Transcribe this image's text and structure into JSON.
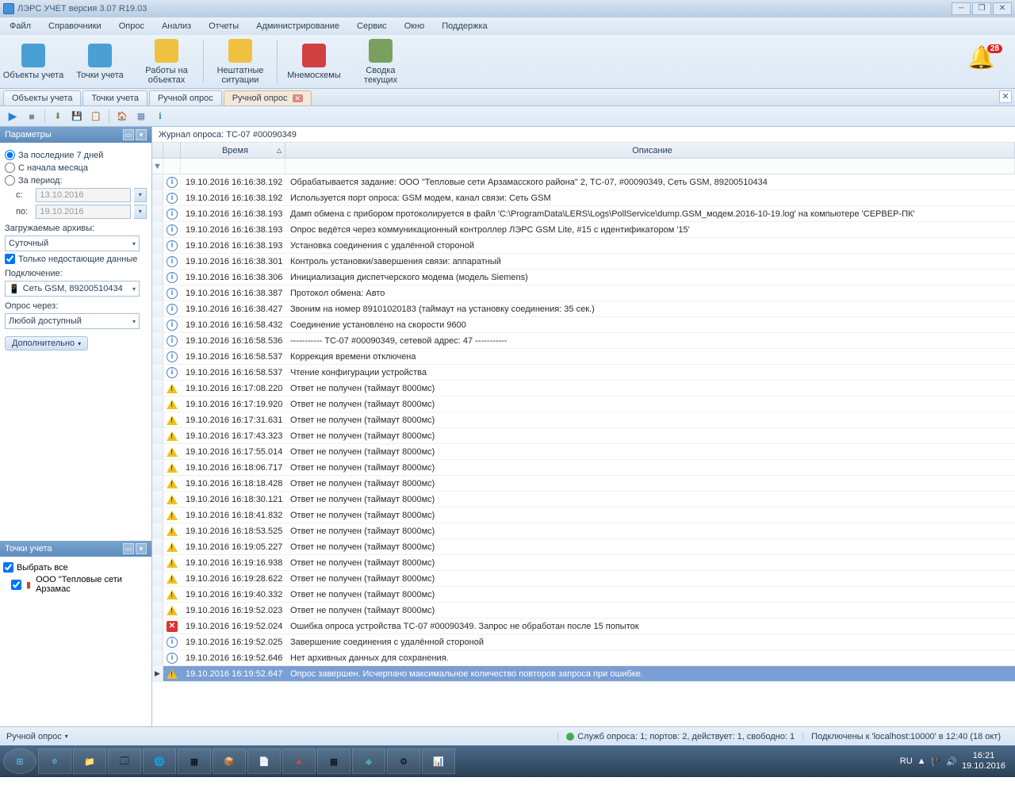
{
  "title": "ЛЭРС УЧЕТ версия 3.07 R19.03",
  "menu": [
    "Файл",
    "Справочники",
    "Опрос",
    "Анализ",
    "Отчеты",
    "Администрирование",
    "Сервис",
    "Окно",
    "Поддержка"
  ],
  "toolbar": [
    {
      "label": "Объекты учета",
      "color": "#4aa0d4"
    },
    {
      "label": "Точки учета",
      "color": "#4aa0d4"
    },
    {
      "label": "Работы на объектах",
      "color": "#f0c040"
    },
    {
      "label": "Нештатные ситуации",
      "color": "#f0c040"
    },
    {
      "label": "Мнемосхемы",
      "color": "#d04040"
    },
    {
      "label": "Сводка текущих",
      "color": "#7aa060"
    }
  ],
  "bell_count": "28",
  "tabs": [
    {
      "label": "Объекты учета",
      "active": false,
      "close": false
    },
    {
      "label": "Точки учета",
      "active": false,
      "close": false
    },
    {
      "label": "Ручной опрос",
      "active": false,
      "close": false
    },
    {
      "label": "Ручной опрос",
      "active": true,
      "close": true
    }
  ],
  "params": {
    "header": "Параметры",
    "opt_last7": "За последние 7 дней",
    "opt_month": "С начала месяца",
    "opt_period": "За период:",
    "from_lbl": "с:",
    "from_val": "13.10.2016",
    "to_lbl": "по:",
    "to_val": "19.10.2016",
    "archives_lbl": "Загружаемые архивы:",
    "archive_val": "Суточный",
    "missing_only": "Только недостающие данные",
    "connection_lbl": "Подключение:",
    "connection_val": "Сеть GSM, 89200510434",
    "pollvia_lbl": "Опрос через:",
    "pollvia_val": "Любой доступный",
    "more_btn": "Дополнительно"
  },
  "points": {
    "header": "Точки учета",
    "select_all": "Выбрать все",
    "item": "ООО \"Тепловые сети Арзамас"
  },
  "journal_title": "Журнал опроса: ТС-07 #00090349",
  "grid": {
    "col_time": "Время",
    "col_desc": "Описание"
  },
  "rows": [
    {
      "t": "i",
      "tm": "19.10.2016 16:16:38.192",
      "d": "Обрабатывается задание: ООО \"Тепловые сети Арзамасского района\" 2, ТС-07, #00090349, Сеть GSM, 89200510434"
    },
    {
      "t": "i",
      "tm": "19.10.2016 16:16:38.192",
      "d": "Используется порт опроса: GSM модем, канал связи: Сеть GSM"
    },
    {
      "t": "i",
      "tm": "19.10.2016 16:16:38.193",
      "d": "Дамп обмена с прибором протоколируется в файл 'C:\\ProgramData\\LERS\\Logs\\PollService\\dump.GSM_модем.2016-10-19.log' на компьютере 'СЕРВЕР-ПК'"
    },
    {
      "t": "i",
      "tm": "19.10.2016 16:16:38.193",
      "d": "Опрос ведётся через коммуникационный контроллер ЛЭРС GSM Lite, #15 с идентификатором '15'"
    },
    {
      "t": "i",
      "tm": "19.10.2016 16:16:38.193",
      "d": "Установка соединения с удалённой стороной"
    },
    {
      "t": "i",
      "tm": "19.10.2016 16:16:38.301",
      "d": "Контроль установки/завершения связи: аппаратный"
    },
    {
      "t": "i",
      "tm": "19.10.2016 16:16:38.306",
      "d": "Инициализация диспетчерского модема (модель Siemens)"
    },
    {
      "t": "i",
      "tm": "19.10.2016 16:16:38.387",
      "d": "Протокол обмена: Авто"
    },
    {
      "t": "i",
      "tm": "19.10.2016 16:16:38.427",
      "d": "Звоним на номер 89101020183 (таймаут на установку соединения: 35 сек.)"
    },
    {
      "t": "i",
      "tm": "19.10.2016 16:16:58.432",
      "d": "Соединение установлено на скорости 9600"
    },
    {
      "t": "i",
      "tm": "19.10.2016 16:16:58.536",
      "d": "----------- ТС-07 #00090349, сетевой адрес: 47 -----------"
    },
    {
      "t": "i",
      "tm": "19.10.2016 16:16:58.537",
      "d": "Коррекция времени отключена"
    },
    {
      "t": "i",
      "tm": "19.10.2016 16:16:58.537",
      "d": "Чтение конфигурации устройства"
    },
    {
      "t": "w",
      "tm": "19.10.2016 16:17:08.220",
      "d": "Ответ не получен (таймаут 8000мс)"
    },
    {
      "t": "w",
      "tm": "19.10.2016 16:17:19.920",
      "d": "Ответ не получен (таймаут 8000мс)"
    },
    {
      "t": "w",
      "tm": "19.10.2016 16:17:31.631",
      "d": "Ответ не получен (таймаут 8000мс)"
    },
    {
      "t": "w",
      "tm": "19.10.2016 16:17:43.323",
      "d": "Ответ не получен (таймаут 8000мс)"
    },
    {
      "t": "w",
      "tm": "19.10.2016 16:17:55.014",
      "d": "Ответ не получен (таймаут 8000мс)"
    },
    {
      "t": "w",
      "tm": "19.10.2016 16:18:06.717",
      "d": "Ответ не получен (таймаут 8000мс)"
    },
    {
      "t": "w",
      "tm": "19.10.2016 16:18:18.428",
      "d": "Ответ не получен (таймаут 8000мс)"
    },
    {
      "t": "w",
      "tm": "19.10.2016 16:18:30.121",
      "d": "Ответ не получен (таймаут 8000мс)"
    },
    {
      "t": "w",
      "tm": "19.10.2016 16:18:41.832",
      "d": "Ответ не получен (таймаут 8000мс)"
    },
    {
      "t": "w",
      "tm": "19.10.2016 16:18:53.525",
      "d": "Ответ не получен (таймаут 8000мс)"
    },
    {
      "t": "w",
      "tm": "19.10.2016 16:19:05.227",
      "d": "Ответ не получен (таймаут 8000мс)"
    },
    {
      "t": "w",
      "tm": "19.10.2016 16:19:16.938",
      "d": "Ответ не получен (таймаут 8000мс)"
    },
    {
      "t": "w",
      "tm": "19.10.2016 16:19:28.622",
      "d": "Ответ не получен (таймаут 8000мс)"
    },
    {
      "t": "w",
      "tm": "19.10.2016 16:19:40.332",
      "d": "Ответ не получен (таймаут 8000мс)"
    },
    {
      "t": "w",
      "tm": "19.10.2016 16:19:52.023",
      "d": "Ответ не получен (таймаут 8000мс)"
    },
    {
      "t": "e",
      "tm": "19.10.2016 16:19:52.024",
      "d": "Ошибка опроса устройства ТС-07 #00090349. Запрос не обработан после 15 попыток"
    },
    {
      "t": "i",
      "tm": "19.10.2016 16:19:52.025",
      "d": "Завершение соединения с удалённой стороной"
    },
    {
      "t": "i",
      "tm": "19.10.2016 16:19:52.646",
      "d": "Нет архивных данных для сохранения."
    },
    {
      "t": "w",
      "tm": "19.10.2016 16:19:52.647",
      "d": "Опрос завершен. Исчерпано максимальное количество повторов запроса при ошибке.",
      "sel": true
    }
  ],
  "status": {
    "left": "Ручной опрос",
    "services": "Служб опроса: 1; портов: 2, действует: 1, свободно: 1",
    "conn": "Подключены к 'localhost:10000' в 12:40 (18 окт)"
  },
  "tray": {
    "lang": "RU",
    "time": "16:21",
    "date": "19.10.2016"
  }
}
